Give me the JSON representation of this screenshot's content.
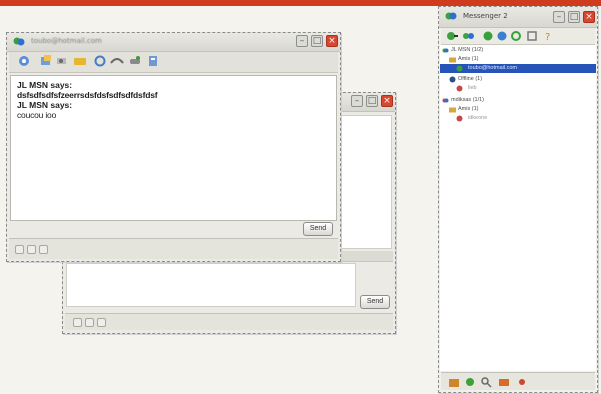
{
  "chat_front": {
    "title": "toubo@hotmail.com",
    "messages": [
      {
        "sender": "JL MSN says:",
        "text": "dsfsdfsdfsfzeerrsdsfdsfsdfsdfdsfdsf"
      },
      {
        "sender": "JL MSN says:",
        "text": "coucou ioo"
      }
    ],
    "send_label": "Send"
  },
  "chat_back": {
    "send_label": "Send"
  },
  "messenger": {
    "title": "Messenger 2",
    "groups": [
      {
        "name": "JL MSN (1/2)",
        "sub": [
          {
            "name": "Amis (1)",
            "contacts": [
              "toubo@hotmail.com"
            ]
          },
          {
            "name": "Offline (1)",
            "contacts": [
              "lieb"
            ]
          }
        ]
      },
      {
        "name": "mdiksas (1/1)",
        "sub": [
          {
            "name": "Amis (1)",
            "contacts": [
              "idkeone"
            ]
          }
        ]
      }
    ]
  },
  "colors": {
    "accent_band": "#cf3b1c",
    "selection": "#2754b8",
    "close_button": "#d9452e"
  }
}
